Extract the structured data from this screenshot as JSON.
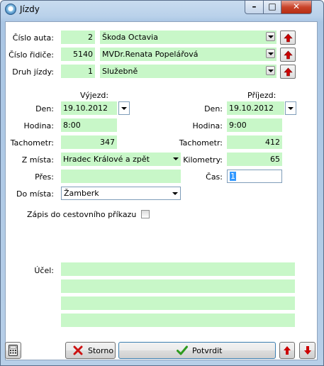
{
  "window": {
    "title": "Jízdy",
    "min_label": "–",
    "max_label": "□",
    "close_label": "✕"
  },
  "car": {
    "label": "Číslo auta:",
    "number": "2",
    "name": "Škoda Octavia"
  },
  "driver": {
    "label": "Číslo řidiče:",
    "number": "5140",
    "name": "MVDr.Renata Popelářová"
  },
  "trip_type": {
    "label": "Druh jízdy:",
    "number": "1",
    "name": "Služebně"
  },
  "departure": {
    "heading": "Výjezd:",
    "day_label": "Den:",
    "day": "19.10.2012",
    "hour_label": "Hodina:",
    "hour": "8:00",
    "odometer_label": "Tachometr:",
    "odometer": "347",
    "from_label": "Z místa:",
    "from": "Hradec Králové a zpět",
    "via_label": "Přes:",
    "via": "",
    "to_label": "Do místa:",
    "to": "Žamberk"
  },
  "arrival": {
    "heading": "Příjezd:",
    "day_label": "Den:",
    "day": "19.10.2012",
    "hour_label": "Hodina:",
    "hour": "9:00",
    "odometer_label": "Tachometr:",
    "odometer": "412",
    "km_label": "Kilometry:",
    "km": "65",
    "time_label": "Čas:",
    "time": "1"
  },
  "travel_order": {
    "label": "Zápis do cestovního příkazu",
    "checked": false
  },
  "purpose": {
    "label": "Účel:",
    "lines": [
      "",
      "",
      "",
      ""
    ]
  },
  "buttons": {
    "cancel": "Storno",
    "confirm": "Potvrdit"
  },
  "colors": {
    "field_bg": "#c8f7c8",
    "accent_red": "#cc0000",
    "confirm_green": "#2e9a1e"
  }
}
